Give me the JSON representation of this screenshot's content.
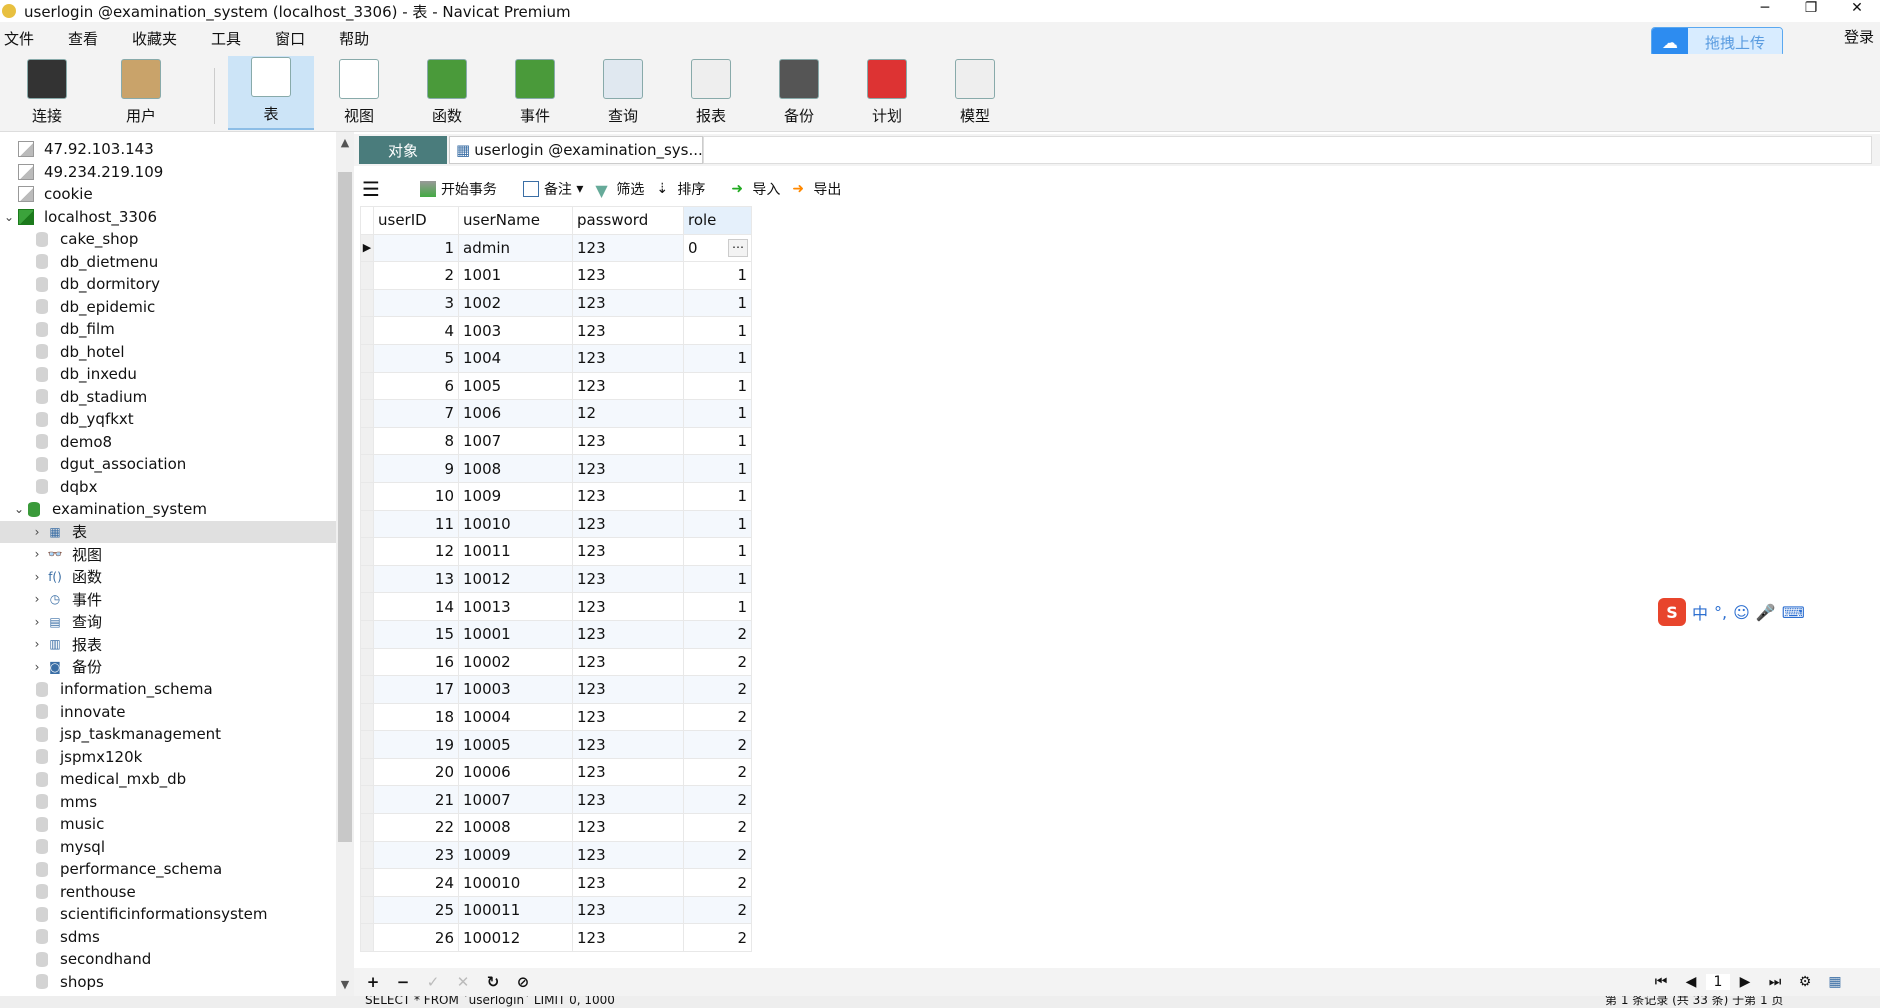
{
  "window": {
    "title": "userlogin @examination_system (localhost_3306) - 表 - Navicat Premium"
  },
  "menu": [
    "文件",
    "查看",
    "收藏夹",
    "工具",
    "窗口",
    "帮助"
  ],
  "upload_label": "拖拽上传",
  "login_label": "登录",
  "toolbar": [
    {
      "label": "连接",
      "icon": "connection-icon"
    },
    {
      "label": "用户",
      "icon": "user-icon"
    },
    {
      "label": "表",
      "icon": "table-icon"
    },
    {
      "label": "视图",
      "icon": "view-icon"
    },
    {
      "label": "函数",
      "icon": "function-icon"
    },
    {
      "label": "事件",
      "icon": "event-icon"
    },
    {
      "label": "查询",
      "icon": "query-icon"
    },
    {
      "label": "报表",
      "icon": "report-icon"
    },
    {
      "label": "备份",
      "icon": "backup-icon"
    },
    {
      "label": "计划",
      "icon": "schedule-icon"
    },
    {
      "label": "模型",
      "icon": "model-icon"
    }
  ],
  "tree": {
    "servers_top": [
      "47.92.103.143",
      "49.234.219.109",
      "cookie"
    ],
    "server": "localhost_3306",
    "dbs_before": [
      "cake_shop",
      "db_dietmenu",
      "db_dormitory",
      "db_epidemic",
      "db_film",
      "db_hotel",
      "db_inxedu",
      "db_stadium",
      "db_yqfkxt",
      "demo8",
      "dgut_association",
      "dqbx"
    ],
    "open_db": "examination_system",
    "objects": [
      {
        "label": "表",
        "icon": "▦"
      },
      {
        "label": "视图",
        "icon": "👓"
      },
      {
        "label": "函数",
        "icon": "f()"
      },
      {
        "label": "事件",
        "icon": "◷"
      },
      {
        "label": "查询",
        "icon": "▤"
      },
      {
        "label": "报表",
        "icon": "▥"
      },
      {
        "label": "备份",
        "icon": "◙"
      }
    ],
    "dbs_after": [
      "information_schema",
      "innovate",
      "jsp_taskmanagement",
      "jspmx120k",
      "medical_mxb_db",
      "mms",
      "music",
      "mysql",
      "performance_schema",
      "renthouse",
      "scientificinformationsystem",
      "sdms",
      "secondhand",
      "shops"
    ]
  },
  "tabs": {
    "objects": "对象",
    "table": "userlogin @examination_sys..."
  },
  "grid_toolbar": {
    "begin_tx": "开始事务",
    "memo": "备注",
    "filter": "筛选",
    "sort": "排序",
    "import": "导入",
    "export": "导出"
  },
  "columns": [
    "userID",
    "userName",
    "password",
    "role"
  ],
  "rows": [
    [
      "1",
      "admin",
      "123",
      "0"
    ],
    [
      "2",
      "1001",
      "123",
      "1"
    ],
    [
      "3",
      "1002",
      "123",
      "1"
    ],
    [
      "4",
      "1003",
      "123",
      "1"
    ],
    [
      "5",
      "1004",
      "123",
      "1"
    ],
    [
      "6",
      "1005",
      "123",
      "1"
    ],
    [
      "7",
      "1006",
      "12",
      "1"
    ],
    [
      "8",
      "1007",
      "123",
      "1"
    ],
    [
      "9",
      "1008",
      "123",
      "1"
    ],
    [
      "10",
      "1009",
      "123",
      "1"
    ],
    [
      "11",
      "10010",
      "123",
      "1"
    ],
    [
      "12",
      "10011",
      "123",
      "1"
    ],
    [
      "13",
      "10012",
      "123",
      "1"
    ],
    [
      "14",
      "10013",
      "123",
      "1"
    ],
    [
      "15",
      "10001",
      "123",
      "2"
    ],
    [
      "16",
      "10002",
      "123",
      "2"
    ],
    [
      "17",
      "10003",
      "123",
      "2"
    ],
    [
      "18",
      "10004",
      "123",
      "2"
    ],
    [
      "19",
      "10005",
      "123",
      "2"
    ],
    [
      "20",
      "10006",
      "123",
      "2"
    ],
    [
      "21",
      "10007",
      "123",
      "2"
    ],
    [
      "22",
      "10008",
      "123",
      "2"
    ],
    [
      "23",
      "10009",
      "123",
      "2"
    ],
    [
      "24",
      "100010",
      "123",
      "2"
    ],
    [
      "25",
      "100011",
      "123",
      "2"
    ],
    [
      "26",
      "100012",
      "123",
      "2"
    ]
  ],
  "pager": {
    "page": "1"
  },
  "status": {
    "sql": "SELECT * FROM `userlogin` LIMIT 0, 1000",
    "count": "第 1 条记录 (共 33 条) 于第 1 页"
  },
  "ime": [
    "中",
    "°,",
    "☺",
    "🎤",
    "⌨"
  ]
}
